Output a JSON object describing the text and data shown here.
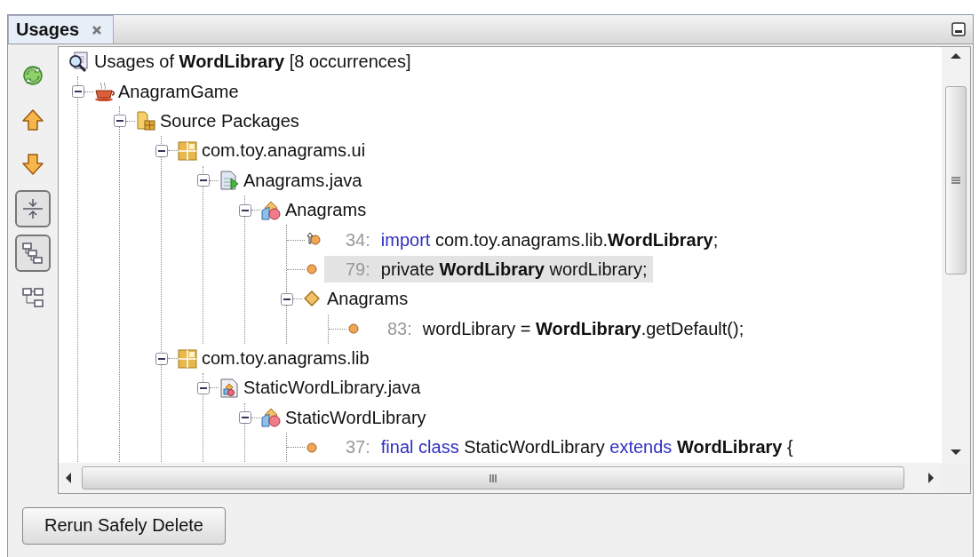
{
  "tabs": [
    {
      "label": "Usages",
      "selected": true
    }
  ],
  "toolbar": [
    {
      "kind": "refresh",
      "pressed": false
    },
    {
      "kind": "previous",
      "pressed": false
    },
    {
      "kind": "next",
      "pressed": false
    },
    {
      "kind": "merge",
      "pressed": true
    },
    {
      "kind": "logical",
      "pressed": true
    },
    {
      "kind": "physical",
      "pressed": false
    }
  ],
  "tree": {
    "title": "Usages of **WordLibrary** [8 occurrences]",
    "children": [
      {
        "kind": "project",
        "label": "AnagramGame",
        "expanded": true,
        "children": [
          {
            "kind": "source-folder",
            "label": "Source Packages",
            "expanded": true,
            "children": [
              {
                "kind": "package",
                "label": "com.toy.anagrams.ui",
                "expanded": true,
                "children": [
                  {
                    "kind": "form-file",
                    "label": "Anagrams.java",
                    "expanded": true,
                    "children": [
                      {
                        "kind": "class",
                        "label": "Anagrams",
                        "expanded": true,
                        "children": [
                          {
                            "kind": "import-usage",
                            "line": "34:",
                            "selected": false,
                            "tokens": [
                              {
                                "kind": "keyword",
                                "text": "import"
                              },
                              {
                                "kind": "plain",
                                "text": " com.toy.anagrams.lib."
                              },
                              {
                                "kind": "match",
                                "text": "WordLibrary"
                              },
                              {
                                "kind": "plain",
                                "text": ";"
                              }
                            ]
                          },
                          {
                            "kind": "usage",
                            "line": "79:",
                            "selected": true,
                            "tokens": [
                              {
                                "kind": "plain",
                                "text": "private "
                              },
                              {
                                "kind": "match",
                                "text": "WordLibrary"
                              },
                              {
                                "kind": "plain",
                                "text": " wordLibrary;"
                              }
                            ]
                          },
                          {
                            "kind": "method",
                            "label": "Anagrams",
                            "expanded": true,
                            "children": [
                              {
                                "kind": "usage",
                                "line": "83:",
                                "selected": false,
                                "tokens": [
                                  {
                                    "kind": "plain",
                                    "text": "wordLibrary = "
                                  },
                                  {
                                    "kind": "match",
                                    "text": "WordLibrary"
                                  },
                                  {
                                    "kind": "plain",
                                    "text": ".getDefault();"
                                  }
                                ]
                              }
                            ]
                          }
                        ]
                      }
                    ]
                  }
                ]
              },
              {
                "kind": "package",
                "label": "com.toy.anagrams.lib",
                "expanded": true,
                "children": [
                  {
                    "kind": "class-file",
                    "label": "StaticWordLibrary.java",
                    "expanded": true,
                    "children": [
                      {
                        "kind": "class",
                        "label": "StaticWordLibrary",
                        "expanded": true,
                        "children": [
                          {
                            "kind": "usage",
                            "line": "37:",
                            "selected": false,
                            "tokens": [
                              {
                                "kind": "keyword",
                                "text": "final class"
                              },
                              {
                                "kind": "plain",
                                "text": " StaticWordLibrary "
                              },
                              {
                                "kind": "keyword",
                                "text": "extends "
                              },
                              {
                                "kind": "match",
                                "text": "WordLibrary"
                              },
                              {
                                "kind": "plain",
                                "text": " {"
                              }
                            ]
                          }
                        ]
                      }
                    ]
                  }
                ]
              }
            ]
          }
        ]
      }
    ]
  },
  "button": "Rerun Safely Delete"
}
